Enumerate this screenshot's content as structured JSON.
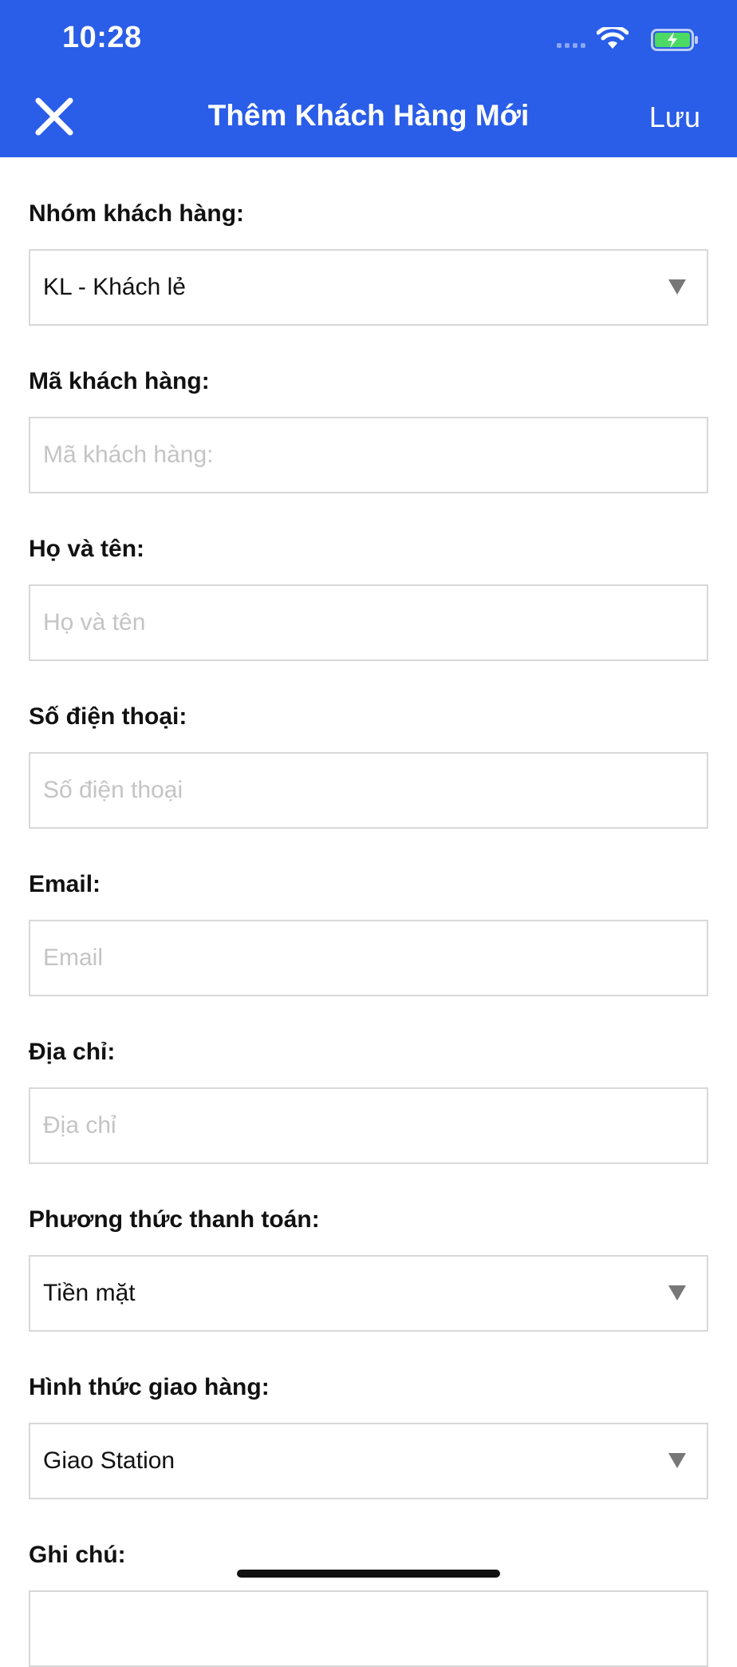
{
  "status_bar": {
    "time": "10:28"
  },
  "header": {
    "title": "Thêm Khách Hàng Mới",
    "save_label": "Lưu"
  },
  "form": {
    "customer_group": {
      "label": "Nhóm khách hàng:",
      "value": "KL - Khách lẻ"
    },
    "customer_code": {
      "label": "Mã khách hàng:",
      "placeholder": "Mã khách hàng:"
    },
    "full_name": {
      "label": "Họ và tên:",
      "placeholder": "Họ và tên"
    },
    "phone": {
      "label": "Số điện thoại:",
      "placeholder": "Số điện thoại"
    },
    "email": {
      "label": "Email:",
      "placeholder": "Email"
    },
    "address": {
      "label": "Địa chỉ:",
      "placeholder": "Địa chỉ"
    },
    "payment_method": {
      "label": "Phương thức thanh toán:",
      "value": "Tiền mặt"
    },
    "delivery_method": {
      "label": "Hình thức giao hàng:",
      "value": "Giao Station"
    },
    "note": {
      "label": "Ghi chú:"
    }
  },
  "colors": {
    "header_bg": "#2a5de8",
    "battery_fill": "#4cd964"
  }
}
